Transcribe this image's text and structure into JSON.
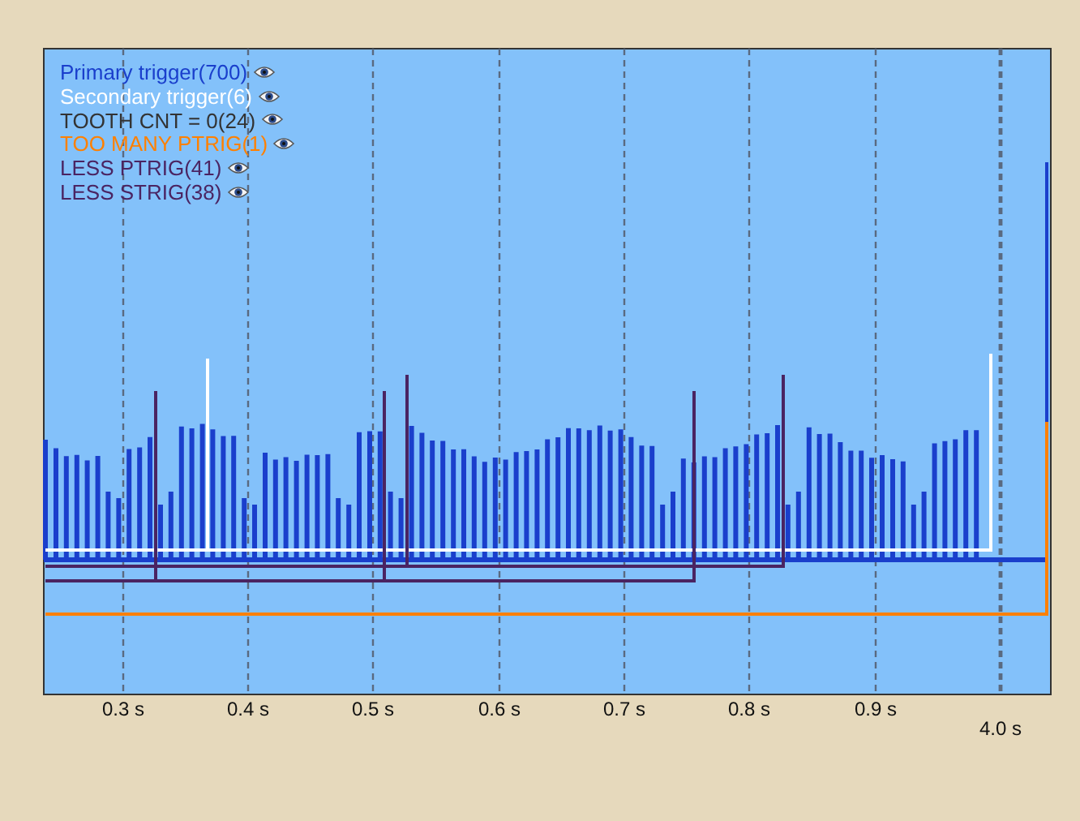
{
  "legend": [
    {
      "label": "Primary trigger(700)",
      "color": "#1a3fcc"
    },
    {
      "label": "Secondary trigger(6)",
      "color": "#ffffff"
    },
    {
      "label": "TOOTH CNT = 0(24)",
      "color": "#333333"
    },
    {
      "label": "TOO MANY PTRIG(1)",
      "color": "#ff8000"
    },
    {
      "label": "LESS PTRIG(41)",
      "color": "#4a2462"
    },
    {
      "label": "LESS STRIG(38)",
      "color": "#4a2462"
    }
  ],
  "x_axis": {
    "ticks": [
      "0.3 s",
      "0.4 s",
      "0.5 s",
      "0.6 s",
      "0.7 s",
      "0.8 s",
      "0.9 s"
    ],
    "end_label": "4.0 s"
  }
}
